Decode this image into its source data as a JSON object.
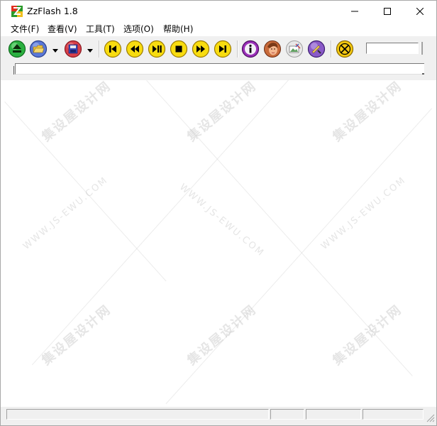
{
  "window": {
    "title": "ZzFlash 1.8",
    "controls": {
      "minimize": "minimize-icon",
      "maximize": "maximize-icon",
      "close": "close-icon"
    }
  },
  "menu": [
    {
      "label": "文件(F)"
    },
    {
      "label": "查看(V)"
    },
    {
      "label": "工具(T)"
    },
    {
      "label": "选项(O)"
    },
    {
      "label": "帮助(H)"
    }
  ],
  "toolbar": {
    "buttons": [
      {
        "icon": "eject-icon",
        "color": "#22a83a"
      },
      {
        "icon": "open-folder-icon",
        "color": "#3a56b8"
      },
      {
        "icon": "save-disk-icon",
        "color": "#c8303a"
      },
      {
        "icon": "previous-track-icon",
        "color": "#f5d400"
      },
      {
        "icon": "rewind-icon",
        "color": "#f5d400"
      },
      {
        "icon": "play-pause-icon",
        "color": "#f5d400"
      },
      {
        "icon": "stop-icon",
        "color": "#f5d400"
      },
      {
        "icon": "fast-forward-icon",
        "color": "#f5d400"
      },
      {
        "icon": "next-track-icon",
        "color": "#f5d400"
      },
      {
        "icon": "info-icon",
        "color": "#8a2aa8"
      },
      {
        "icon": "face-icon",
        "color": "#e08050"
      },
      {
        "icon": "capture-icon",
        "color": "#9a9a9a"
      },
      {
        "icon": "tools-icon",
        "color": "#7a4ab0"
      },
      {
        "icon": "fullscreen-icon",
        "color": "#f0c000"
      }
    ]
  },
  "status": {
    "panes": [
      "",
      "",
      "",
      ""
    ]
  },
  "watermark": {
    "cn": "集设屋设计网",
    "url": "WWW.JS-EWU.COM"
  }
}
